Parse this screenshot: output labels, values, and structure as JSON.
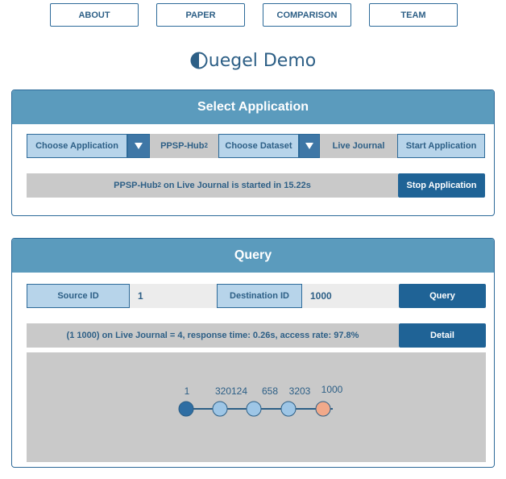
{
  "nav": {
    "about": "ABOUT",
    "paper": "PAPER",
    "comparison": "COMPARISON",
    "team": "TEAM"
  },
  "logo": {
    "letter_icon": "half-circle-q-icon",
    "text": "uegel Demo"
  },
  "select_app": {
    "title": "Select Application",
    "choose_app_label": "Choose Application",
    "app_value": "PPSP-Hub",
    "app_value_sup": "2",
    "choose_dataset_label": "Choose Dataset",
    "dataset_value": "Live Journal",
    "start_label": "Start Application",
    "status_prefix": "PPSP-Hub",
    "status_sup": "2",
    "status_suffix": " on Live Journal is started in 15.22s",
    "stop_label": "Stop Application"
  },
  "query": {
    "title": "Query",
    "source_label": "Source ID",
    "source_value": "1",
    "dest_label": "Destination ID",
    "dest_value": "1000",
    "query_button": "Query",
    "result_text": "(1 1000) on Live Journal = 4, response time: 0.26s, access rate: 97.8%",
    "detail_button": "Detail",
    "path_nodes": [
      "1",
      "320124",
      "658",
      "3203",
      "1000"
    ]
  },
  "colors": {
    "accent": "#5b9bbd",
    "dark_button": "#1f6396",
    "source_node": "#2f6ea3",
    "middle_node": "#9ec6e6",
    "target_node": "#f1a98a"
  }
}
